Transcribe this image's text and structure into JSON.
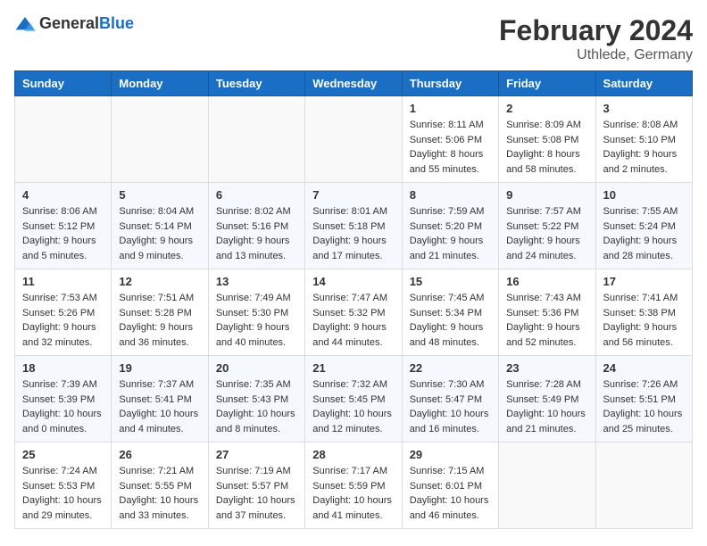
{
  "header": {
    "logo_general": "General",
    "logo_blue": "Blue",
    "main_title": "February 2024",
    "subtitle": "Uthlede, Germany"
  },
  "weekdays": [
    "Sunday",
    "Monday",
    "Tuesday",
    "Wednesday",
    "Thursday",
    "Friday",
    "Saturday"
  ],
  "weeks": [
    [
      {
        "day": "",
        "sunrise": "",
        "sunset": "",
        "daylight": ""
      },
      {
        "day": "",
        "sunrise": "",
        "sunset": "",
        "daylight": ""
      },
      {
        "day": "",
        "sunrise": "",
        "sunset": "",
        "daylight": ""
      },
      {
        "day": "",
        "sunrise": "",
        "sunset": "",
        "daylight": ""
      },
      {
        "day": "1",
        "sunrise": "Sunrise: 8:11 AM",
        "sunset": "Sunset: 5:06 PM",
        "daylight": "Daylight: 8 hours and 55 minutes."
      },
      {
        "day": "2",
        "sunrise": "Sunrise: 8:09 AM",
        "sunset": "Sunset: 5:08 PM",
        "daylight": "Daylight: 8 hours and 58 minutes."
      },
      {
        "day": "3",
        "sunrise": "Sunrise: 8:08 AM",
        "sunset": "Sunset: 5:10 PM",
        "daylight": "Daylight: 9 hours and 2 minutes."
      }
    ],
    [
      {
        "day": "4",
        "sunrise": "Sunrise: 8:06 AM",
        "sunset": "Sunset: 5:12 PM",
        "daylight": "Daylight: 9 hours and 5 minutes."
      },
      {
        "day": "5",
        "sunrise": "Sunrise: 8:04 AM",
        "sunset": "Sunset: 5:14 PM",
        "daylight": "Daylight: 9 hours and 9 minutes."
      },
      {
        "day": "6",
        "sunrise": "Sunrise: 8:02 AM",
        "sunset": "Sunset: 5:16 PM",
        "daylight": "Daylight: 9 hours and 13 minutes."
      },
      {
        "day": "7",
        "sunrise": "Sunrise: 8:01 AM",
        "sunset": "Sunset: 5:18 PM",
        "daylight": "Daylight: 9 hours and 17 minutes."
      },
      {
        "day": "8",
        "sunrise": "Sunrise: 7:59 AM",
        "sunset": "Sunset: 5:20 PM",
        "daylight": "Daylight: 9 hours and 21 minutes."
      },
      {
        "day": "9",
        "sunrise": "Sunrise: 7:57 AM",
        "sunset": "Sunset: 5:22 PM",
        "daylight": "Daylight: 9 hours and 24 minutes."
      },
      {
        "day": "10",
        "sunrise": "Sunrise: 7:55 AM",
        "sunset": "Sunset: 5:24 PM",
        "daylight": "Daylight: 9 hours and 28 minutes."
      }
    ],
    [
      {
        "day": "11",
        "sunrise": "Sunrise: 7:53 AM",
        "sunset": "Sunset: 5:26 PM",
        "daylight": "Daylight: 9 hours and 32 minutes."
      },
      {
        "day": "12",
        "sunrise": "Sunrise: 7:51 AM",
        "sunset": "Sunset: 5:28 PM",
        "daylight": "Daylight: 9 hours and 36 minutes."
      },
      {
        "day": "13",
        "sunrise": "Sunrise: 7:49 AM",
        "sunset": "Sunset: 5:30 PM",
        "daylight": "Daylight: 9 hours and 40 minutes."
      },
      {
        "day": "14",
        "sunrise": "Sunrise: 7:47 AM",
        "sunset": "Sunset: 5:32 PM",
        "daylight": "Daylight: 9 hours and 44 minutes."
      },
      {
        "day": "15",
        "sunrise": "Sunrise: 7:45 AM",
        "sunset": "Sunset: 5:34 PM",
        "daylight": "Daylight: 9 hours and 48 minutes."
      },
      {
        "day": "16",
        "sunrise": "Sunrise: 7:43 AM",
        "sunset": "Sunset: 5:36 PM",
        "daylight": "Daylight: 9 hours and 52 minutes."
      },
      {
        "day": "17",
        "sunrise": "Sunrise: 7:41 AM",
        "sunset": "Sunset: 5:38 PM",
        "daylight": "Daylight: 9 hours and 56 minutes."
      }
    ],
    [
      {
        "day": "18",
        "sunrise": "Sunrise: 7:39 AM",
        "sunset": "Sunset: 5:39 PM",
        "daylight": "Daylight: 10 hours and 0 minutes."
      },
      {
        "day": "19",
        "sunrise": "Sunrise: 7:37 AM",
        "sunset": "Sunset: 5:41 PM",
        "daylight": "Daylight: 10 hours and 4 minutes."
      },
      {
        "day": "20",
        "sunrise": "Sunrise: 7:35 AM",
        "sunset": "Sunset: 5:43 PM",
        "daylight": "Daylight: 10 hours and 8 minutes."
      },
      {
        "day": "21",
        "sunrise": "Sunrise: 7:32 AM",
        "sunset": "Sunset: 5:45 PM",
        "daylight": "Daylight: 10 hours and 12 minutes."
      },
      {
        "day": "22",
        "sunrise": "Sunrise: 7:30 AM",
        "sunset": "Sunset: 5:47 PM",
        "daylight": "Daylight: 10 hours and 16 minutes."
      },
      {
        "day": "23",
        "sunrise": "Sunrise: 7:28 AM",
        "sunset": "Sunset: 5:49 PM",
        "daylight": "Daylight: 10 hours and 21 minutes."
      },
      {
        "day": "24",
        "sunrise": "Sunrise: 7:26 AM",
        "sunset": "Sunset: 5:51 PM",
        "daylight": "Daylight: 10 hours and 25 minutes."
      }
    ],
    [
      {
        "day": "25",
        "sunrise": "Sunrise: 7:24 AM",
        "sunset": "Sunset: 5:53 PM",
        "daylight": "Daylight: 10 hours and 29 minutes."
      },
      {
        "day": "26",
        "sunrise": "Sunrise: 7:21 AM",
        "sunset": "Sunset: 5:55 PM",
        "daylight": "Daylight: 10 hours and 33 minutes."
      },
      {
        "day": "27",
        "sunrise": "Sunrise: 7:19 AM",
        "sunset": "Sunset: 5:57 PM",
        "daylight": "Daylight: 10 hours and 37 minutes."
      },
      {
        "day": "28",
        "sunrise": "Sunrise: 7:17 AM",
        "sunset": "Sunset: 5:59 PM",
        "daylight": "Daylight: 10 hours and 41 minutes."
      },
      {
        "day": "29",
        "sunrise": "Sunrise: 7:15 AM",
        "sunset": "Sunset: 6:01 PM",
        "daylight": "Daylight: 10 hours and 46 minutes."
      },
      {
        "day": "",
        "sunrise": "",
        "sunset": "",
        "daylight": ""
      },
      {
        "day": "",
        "sunrise": "",
        "sunset": "",
        "daylight": ""
      }
    ]
  ]
}
